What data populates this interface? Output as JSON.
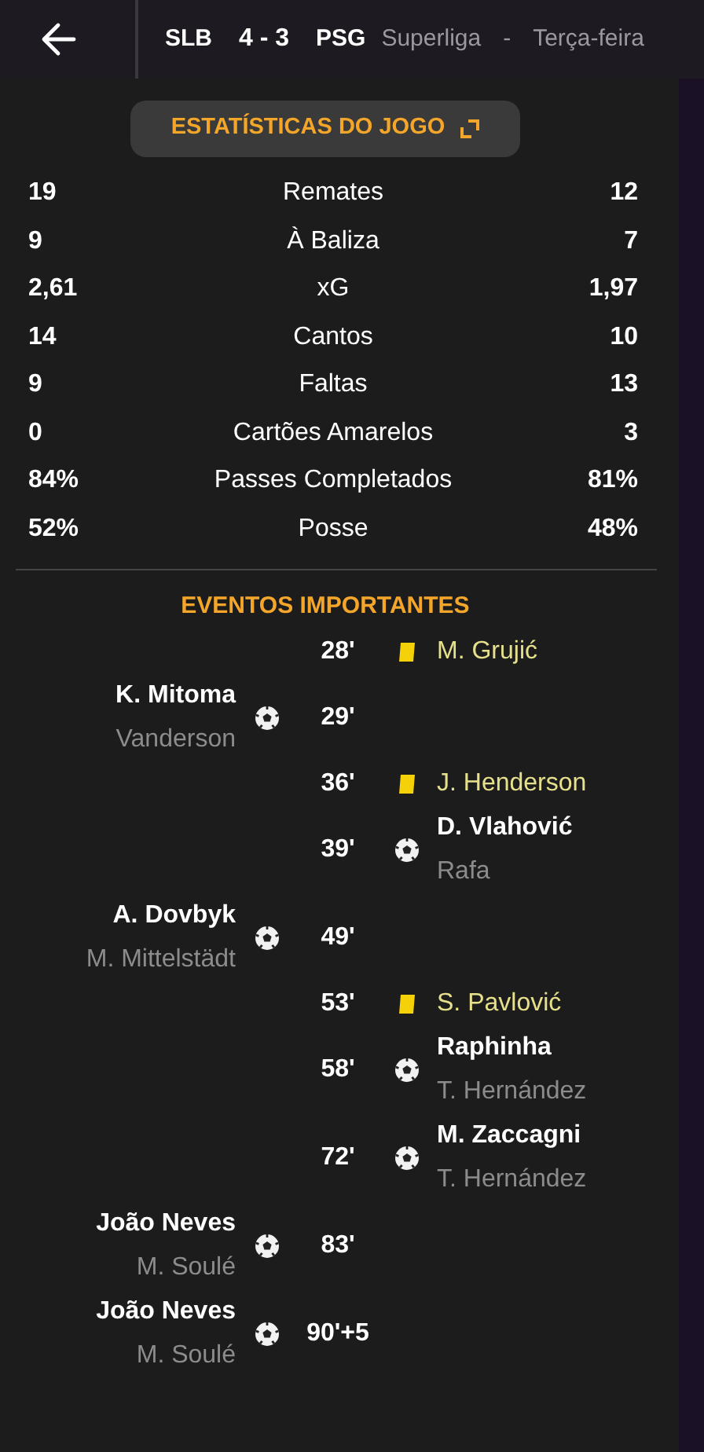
{
  "header": {
    "home": "SLB",
    "score": "4 - 3",
    "away": "PSG",
    "competition": "Superliga",
    "separator": "-",
    "day": "Terça-feira"
  },
  "stats_button": {
    "label": "ESTATÍSTICAS DO JOGO"
  },
  "stats": [
    {
      "home": "19",
      "label": "Remates",
      "away": "12"
    },
    {
      "home": "9",
      "label": "À Baliza",
      "away": "7"
    },
    {
      "home": "2,61",
      "label": "xG",
      "away": "1,97"
    },
    {
      "home": "14",
      "label": "Cantos",
      "away": "10"
    },
    {
      "home": "9",
      "label": "Faltas",
      "away": "13"
    },
    {
      "home": "0",
      "label": "Cartões Amarelos",
      "away": "3"
    },
    {
      "home": "84%",
      "label": "Passes Completados",
      "away": "81%"
    },
    {
      "home": "52%",
      "label": "Posse",
      "away": "48%"
    }
  ],
  "events_title": "EVENTOS IMPORTANTES",
  "events": [
    {
      "kind": "yellow",
      "minute": "28'",
      "away": {
        "player": "M. Grujić"
      }
    },
    {
      "kind": "goal",
      "minute": "29'",
      "home": {
        "player": "K. Mitoma",
        "assist": "Vanderson"
      }
    },
    {
      "kind": "yellow",
      "minute": "36'",
      "away": {
        "player": "J. Henderson"
      }
    },
    {
      "kind": "goal",
      "minute": "39'",
      "away": {
        "player": "D. Vlahović",
        "assist": "Rafa"
      }
    },
    {
      "kind": "goal",
      "minute": "49'",
      "home": {
        "player": "A. Dovbyk",
        "assist": "M. Mittelstädt"
      }
    },
    {
      "kind": "yellow",
      "minute": "53'",
      "away": {
        "player": "S. Pavlović"
      }
    },
    {
      "kind": "goal",
      "minute": "58'",
      "away": {
        "player": "Raphinha",
        "assist": "T. Hernández"
      }
    },
    {
      "kind": "goal",
      "minute": "72'",
      "away": {
        "player": "M. Zaccagni",
        "assist": "T. Hernández"
      }
    },
    {
      "kind": "goal",
      "minute": "83'",
      "home": {
        "player": "João Neves",
        "assist": "M. Soulé"
      }
    },
    {
      "kind": "goal",
      "minute": "90'+5",
      "home": {
        "player": "João Neves",
        "assist": "M. Soulé"
      }
    }
  ]
}
